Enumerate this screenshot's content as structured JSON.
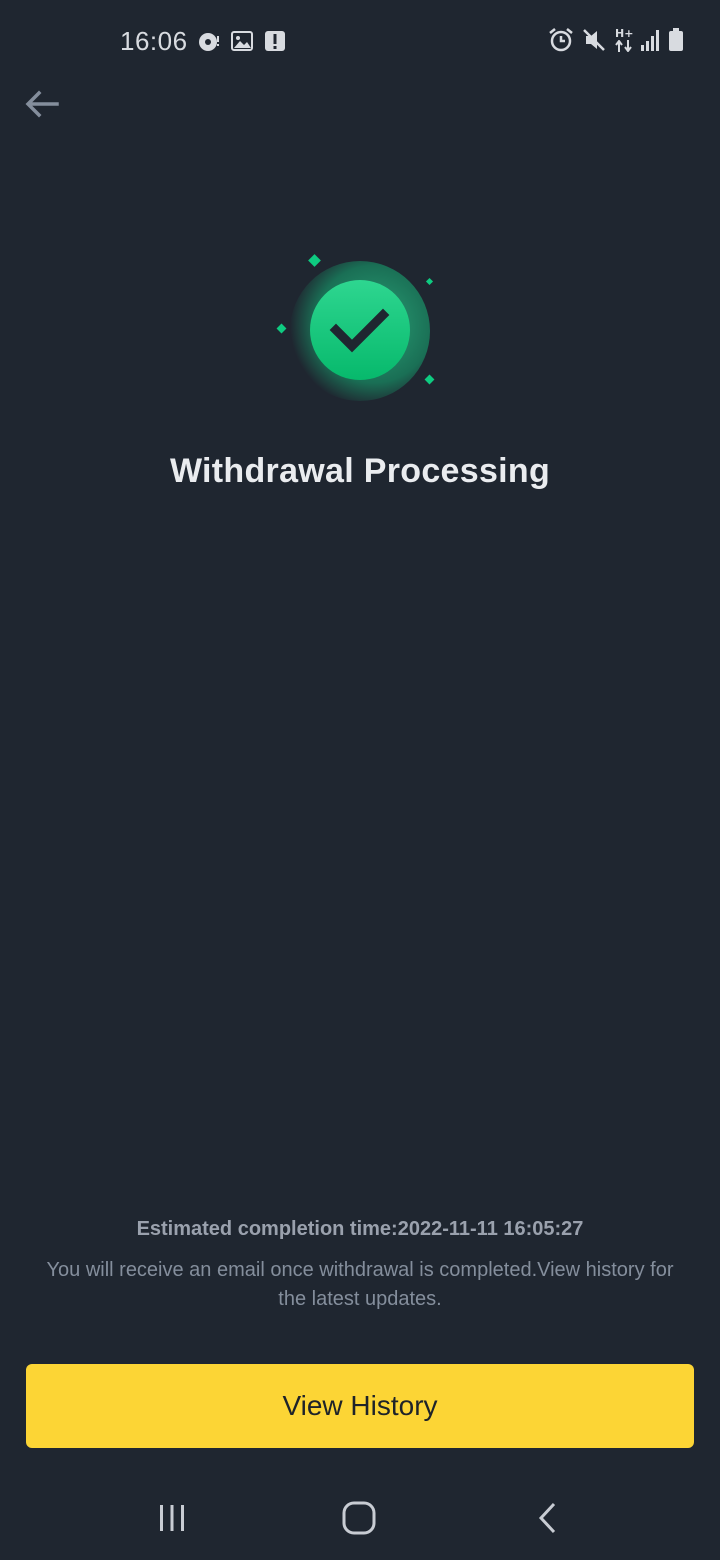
{
  "status_bar": {
    "time": "16:06",
    "left_icons": [
      "sync-icon",
      "image-icon",
      "alert-icon"
    ],
    "right_icons": [
      "alarm-icon",
      "mute-icon",
      "h-plus-data-icon",
      "signal-icon",
      "battery-icon"
    ],
    "data_label": "H+"
  },
  "header": {
    "back_icon": "arrow-left-icon"
  },
  "status": {
    "icon": "check-circle-icon",
    "accent_color": "#0ecb81",
    "title": "Withdrawal Processing"
  },
  "info": {
    "estimate": "Estimated completion time:2022-11-11 16:05:27",
    "message": "You will receive an email once withdrawal is completed.View history for the latest updates."
  },
  "actions": {
    "view_history_label": "View History",
    "button_color": "#fcd535"
  },
  "nav_bar": {
    "items": [
      "recent-apps-icon",
      "home-icon",
      "back-icon"
    ]
  }
}
